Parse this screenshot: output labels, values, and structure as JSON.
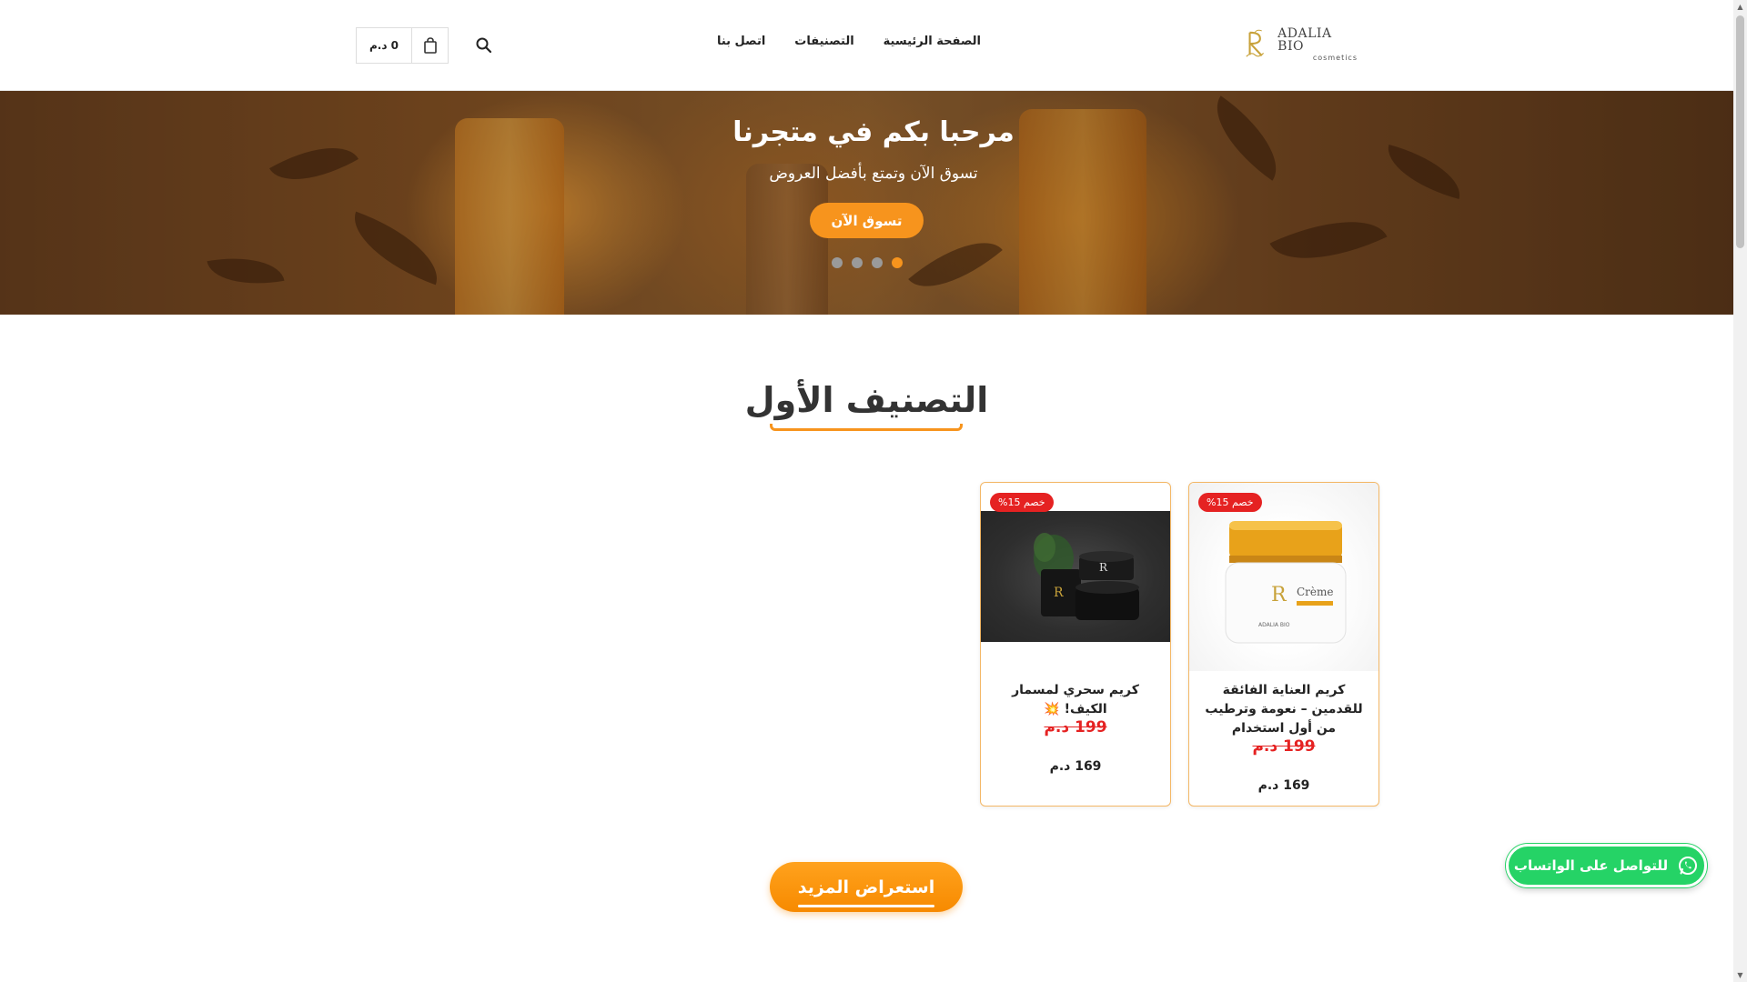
{
  "header": {
    "logo": {
      "title": "ADALIA BIO",
      "subtitle": "cosmetics"
    },
    "nav": [
      {
        "label": "الصفحة الرئيسية"
      },
      {
        "label": "التصنيفات"
      },
      {
        "label": "اتصل بنا"
      }
    ],
    "cart_total": "0 د.م"
  },
  "hero": {
    "title": "مرحبا بكم في متجرنا",
    "subtitle": "تسوق الآن وتمتع بأفضل العروض",
    "cta": "تسوق الآن",
    "slides": 4,
    "active_slide": 1
  },
  "section": {
    "title": "التصنيف الأول"
  },
  "products": [
    {
      "badge": "خصم 15%",
      "name": "كريم العناية الفائقة للقدمين – نعومة وترطيب من أول استخدام",
      "old_price": "199 د.م",
      "new_price": "169 د.م",
      "image": "cream-jar-gold-lid"
    },
    {
      "badge": "خصم 15%",
      "name": "كريم سحري لمسمار الكيف! 💥",
      "old_price": "199 د.م",
      "new_price": "169 د.م",
      "image": "black-jars-set"
    }
  ],
  "more_button": "استعراض المزيد",
  "whatsapp": {
    "label": "للتواصل على الواتساب",
    "color": "#25d366"
  },
  "colors": {
    "accent": "#f7941d",
    "sale": "#e52222"
  }
}
